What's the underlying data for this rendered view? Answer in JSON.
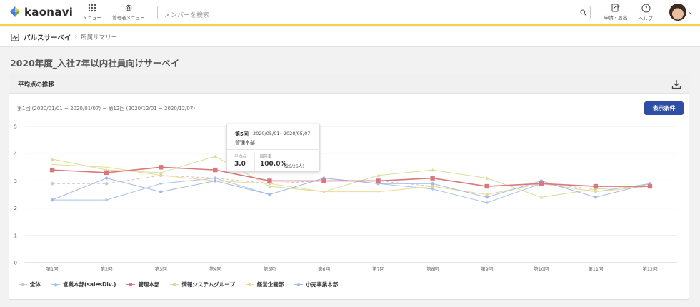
{
  "header": {
    "brand": "kaonavi",
    "menu_label": "メニュー",
    "admin_menu_label": "管理者メニュー",
    "search_placeholder": "メンバーを検索",
    "apply_label": "申請・届出",
    "help_label": "ヘルプ"
  },
  "breadcrumb": {
    "title": "パルスサーベイ",
    "current": "所属サマリー"
  },
  "page_title": "2020年度_入社7年以内社員向けサーベイ",
  "card": {
    "title": "平均点の推移",
    "period": "第1回 (2020/01/01 ~ 2020/01/07) ~ 第12回 (2020/12/01 ~ 2020/12/07)",
    "filter_button": "表示条件"
  },
  "tooltip": {
    "round": "第5回",
    "dates": "2020/05/01~2020/05/07",
    "dept": "管理本部",
    "avg_label": "平均点",
    "avg_value": "3.0",
    "rate_label": "回答率",
    "rate_value": "100.0%",
    "rate_detail": "(26/26人)"
  },
  "colors": {
    "accent": "#2f4fa4",
    "header_border": "#f1d24a"
  },
  "chart_data": {
    "type": "line",
    "categories": [
      "第1回",
      "第2回",
      "第3回",
      "第4回",
      "第5回",
      "第6回",
      "第7回",
      "第8回",
      "第9回",
      "第10回",
      "第11回",
      "第12回"
    ],
    "ylim": [
      0,
      5
    ],
    "yticks": [
      "0",
      "1",
      "2",
      "3",
      "4",
      "5"
    ],
    "grid": true,
    "legend": "bottom-left",
    "series": [
      {
        "name": "全体",
        "color": "#c9c9c9",
        "marker": "circle",
        "dashed": true,
        "highlight": false,
        "values": [
          2.9,
          2.9,
          3.2,
          3.1,
          2.9,
          3.0,
          3.0,
          2.8,
          2.5,
          2.9,
          2.7,
          2.8
        ]
      },
      {
        "name": "営業本部(salesDiv.)",
        "color": "#a9c4e6",
        "marker": "diamond",
        "dashed": false,
        "highlight": false,
        "values": [
          2.3,
          2.3,
          2.9,
          3.1,
          2.5,
          3.1,
          2.9,
          2.7,
          2.2,
          2.9,
          2.6,
          2.9
        ]
      },
      {
        "name": "管理本部",
        "color": "#d9777e",
        "marker": "square",
        "dashed": false,
        "highlight": true,
        "values": [
          3.4,
          3.3,
          3.5,
          3.4,
          3.0,
          3.0,
          3.0,
          3.1,
          2.8,
          2.9,
          2.8,
          2.8
        ]
      },
      {
        "name": "情報システムグループ",
        "color": "#d8dc9c",
        "marker": "triangle",
        "dashed": false,
        "highlight": false,
        "values": [
          3.8,
          3.4,
          3.3,
          3.9,
          2.8,
          2.6,
          3.2,
          3.4,
          3.1,
          2.4,
          2.7,
          2.8
        ]
      },
      {
        "name": "経営企画部",
        "color": "#f0da92",
        "marker": "star",
        "dashed": false,
        "highlight": false,
        "values": [
          3.6,
          3.5,
          3.2,
          3.0,
          2.9,
          2.6,
          2.6,
          2.8,
          2.5,
          2.9,
          2.6,
          2.8
        ]
      },
      {
        "name": "小売事業本部",
        "color": "#a5b8e8",
        "marker": "circle",
        "dashed": false,
        "highlight": false,
        "values": [
          2.3,
          3.1,
          2.6,
          3.0,
          2.5,
          3.1,
          2.9,
          2.9,
          2.4,
          3.0,
          2.4,
          2.9
        ]
      }
    ]
  }
}
